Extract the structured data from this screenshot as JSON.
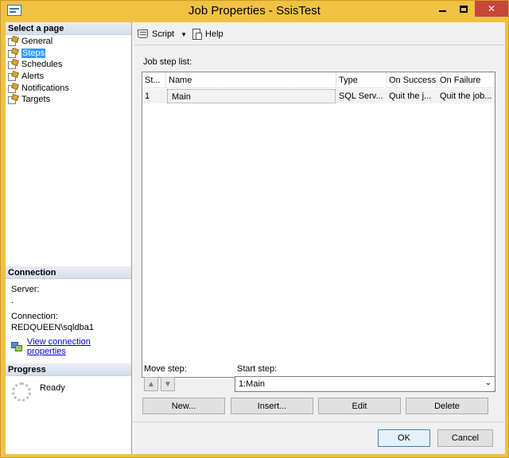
{
  "window": {
    "title": "Job Properties - SsisTest",
    "minimize_glyph": "",
    "maximize_glyph": "",
    "close_glyph": "✕"
  },
  "left_panel": {
    "select_page_header": "Select a page",
    "pages": [
      {
        "label": "General",
        "selected": false
      },
      {
        "label": "Steps",
        "selected": true
      },
      {
        "label": "Schedules",
        "selected": false
      },
      {
        "label": "Alerts",
        "selected": false
      },
      {
        "label": "Notifications",
        "selected": false
      },
      {
        "label": "Targets",
        "selected": false
      }
    ],
    "connection_header": "Connection",
    "server_label": "Server:",
    "server_value": ".",
    "connection_label": "Connection:",
    "connection_value": "REDQUEEN\\sqldba1",
    "view_connection_link": "View connection properties",
    "progress_header": "Progress",
    "progress_status": "Ready"
  },
  "toolbar": {
    "script_label": "Script",
    "script_dropdown_glyph": "▼",
    "help_label": "Help"
  },
  "job_step_list": {
    "label": "Job step list:",
    "columns": [
      "St...",
      "Name",
      "Type",
      "On Success",
      "On Failure"
    ],
    "rows": [
      {
        "step": "1",
        "name": "Main",
        "type": "SQL Serv...",
        "on_success": "Quit the j...",
        "on_failure": "Quit the job..."
      }
    ]
  },
  "move_step": {
    "label": "Move step:",
    "up_glyph": "▲",
    "down_glyph": "▼"
  },
  "start_step": {
    "label": "Start step:",
    "value": "1:Main",
    "chevron": "⌄"
  },
  "buttons": {
    "new": "New...",
    "insert": "Insert...",
    "edit": "Edit",
    "delete": "Delete",
    "ok": "OK",
    "cancel": "Cancel"
  },
  "colors": {
    "title_bar": "#f0c243",
    "close_button": "#c7463a",
    "selected_page": "#3399ff",
    "link": "#0000d0"
  }
}
